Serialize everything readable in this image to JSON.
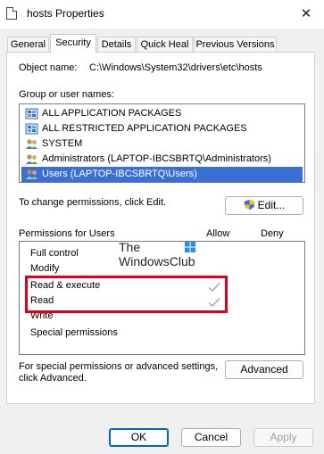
{
  "window": {
    "title": "hosts Properties",
    "close_glyph": "✕"
  },
  "tabs": [
    {
      "label": "General"
    },
    {
      "label": "Security"
    },
    {
      "label": "Details"
    },
    {
      "label": "Quick Heal"
    },
    {
      "label": "Previous Versions"
    }
  ],
  "object": {
    "label": "Object name:",
    "value": "C:\\Windows\\System32\\drivers\\etc\\hosts"
  },
  "groups": {
    "label": "Group or user names:",
    "items": [
      {
        "label": "ALL APPLICATION PACKAGES",
        "icon": "package-icon"
      },
      {
        "label": "ALL RESTRICTED APPLICATION PACKAGES",
        "icon": "package-icon"
      },
      {
        "label": "SYSTEM",
        "icon": "users-icon"
      },
      {
        "label": "Administrators (LAPTOP-IBCSBRTQ\\Administrators)",
        "icon": "users-icon"
      },
      {
        "label": "Users (LAPTOP-IBCSBRTQ\\Users)",
        "icon": "users-icon",
        "selected": true
      }
    ]
  },
  "change_text": "To change permissions, click Edit.",
  "edit_button": "Edit...",
  "permissions": {
    "title": "Permissions for Users",
    "allow_header": "Allow",
    "deny_header": "Deny",
    "rows": [
      {
        "label": "Full control",
        "allow": false
      },
      {
        "label": "Modify",
        "allow": false
      },
      {
        "label": "Read & execute",
        "allow": true
      },
      {
        "label": "Read",
        "allow": true
      },
      {
        "label": "Write",
        "allow": false
      },
      {
        "label": "Special permissions",
        "allow": false
      }
    ]
  },
  "watermark": {
    "line1": "The",
    "line2": "WindowsClub"
  },
  "advanced": {
    "text1": "For special permissions or advanced settings,",
    "text2": "click Advanced.",
    "button": "Advanced"
  },
  "footer": {
    "ok": "OK",
    "cancel": "Cancel",
    "apply": "Apply"
  },
  "colors": {
    "selection": "#3a70d6",
    "highlight_border": "#e0001a",
    "checkmark": "#b4b4b4"
  }
}
